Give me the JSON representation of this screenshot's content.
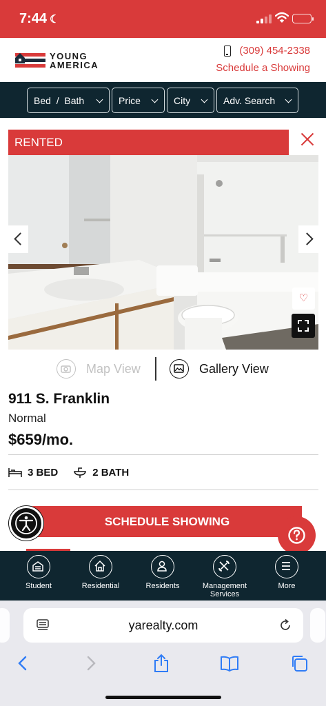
{
  "status_bar": {
    "time": "7:44"
  },
  "header": {
    "logo_line1": "YOUNG",
    "logo_line2": "AMERICA",
    "phone": "(309) 454-2338",
    "schedule_link": "Schedule a Showing"
  },
  "filters": [
    {
      "label": "Bed  /  Bath"
    },
    {
      "label": "Price"
    },
    {
      "label": "City"
    },
    {
      "label": "Adv. Search"
    }
  ],
  "listing": {
    "badge": "RENTED",
    "view_map": "Map View",
    "view_gallery": "Gallery View",
    "address": "911 S. Franklin",
    "city": "Normal",
    "price": "$659/mo.",
    "beds": "3 BED",
    "baths": "2 BATH",
    "cta": "SCHEDULE SHOWING"
  },
  "bottom_nav": [
    {
      "label": "Student",
      "icon": "student-icon"
    },
    {
      "label": "Residential",
      "icon": "house-icon"
    },
    {
      "label": "Residents",
      "icon": "person-icon"
    },
    {
      "label": "Management Services",
      "icon": "tools-icon"
    },
    {
      "label": "More",
      "icon": "menu-icon"
    }
  ],
  "browser": {
    "url": "yarealty.com"
  },
  "colors": {
    "brand_red": "#d93a3a",
    "navy": "#0f2630",
    "browser_blue": "#2f7cf6"
  }
}
